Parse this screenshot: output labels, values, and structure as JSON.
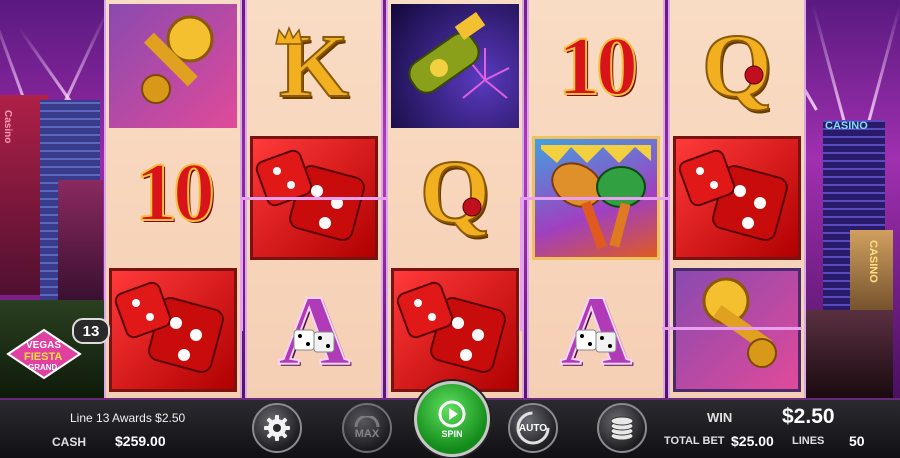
{
  "game": {
    "logo_lines": [
      "VEGAS",
      "FIESTA",
      "GRAND"
    ],
    "active_line_badge": "13",
    "casino_sign_left": "Casino",
    "casino_sign_right_top": "CASINO",
    "casino_sign_right_side": "CASINO",
    "reels": [
      [
        "trumpet",
        "10",
        "dice"
      ],
      [
        "K",
        "dice",
        "A"
      ],
      [
        "champagne",
        "Q",
        "dice"
      ],
      [
        "10",
        "maracas",
        "A"
      ],
      [
        "Q",
        "dice",
        "trumpet"
      ]
    ],
    "symbol_text": {
      "ten": "10",
      "king": "K",
      "queen": "Q",
      "ace": "A"
    }
  },
  "hud": {
    "line_award_text": "Line 13 Awards $2.50",
    "cash_label": "CASH",
    "cash_value": "$259.00",
    "win_label": "WIN",
    "win_value": "$2.50",
    "total_bet_label": "TOTAL BET",
    "total_bet_value": "$25.00",
    "lines_label": "LINES",
    "lines_value": "50",
    "max_label": "MAX",
    "spin_label": "SPIN",
    "auto_label": "AUTO"
  },
  "colors": {
    "accent_pink": "#e8a0f0",
    "spin_green": "#1fa526",
    "reel_bg": "#f9dcc4"
  }
}
